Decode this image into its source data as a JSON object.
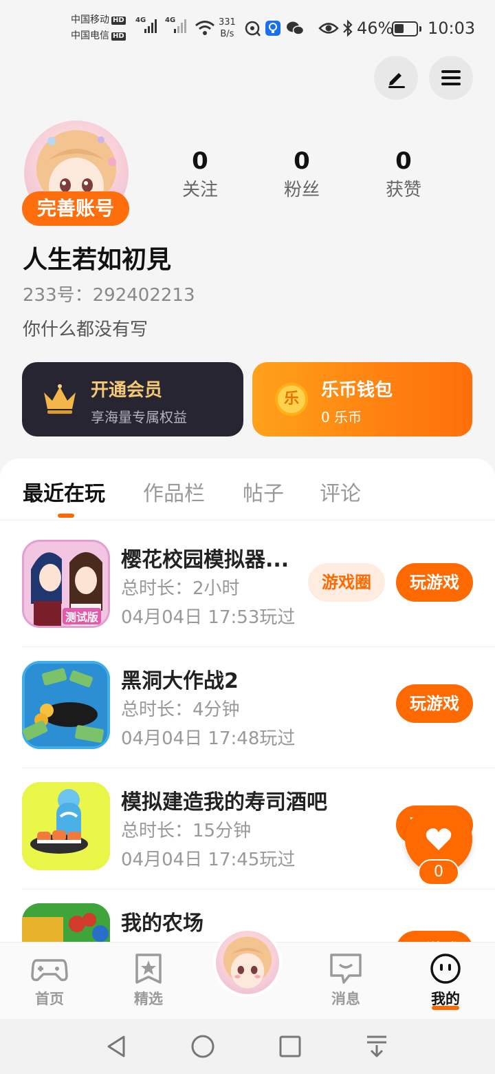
{
  "status_bar": {
    "carrier_1": "中国移动",
    "carrier_2": "中国电信",
    "hd": "HD",
    "net_type": "4G",
    "speed_value": "331",
    "speed_unit": "B/s",
    "battery_percent": "46%",
    "battery_level": 0.46,
    "time": "10:03"
  },
  "header": {
    "edit_icon": "pencil-icon",
    "menu_icon": "hamburger-menu-icon"
  },
  "profile": {
    "complete_label": "完善账号",
    "nickname": "人生若如初見",
    "uid": "233号：292402213",
    "bio": "你什么都没有写",
    "stats": [
      {
        "value": "0",
        "label": "关注"
      },
      {
        "value": "0",
        "label": "粉丝"
      },
      {
        "value": "0",
        "label": "获赞"
      }
    ]
  },
  "cards": {
    "vip": {
      "title": "开通会员",
      "subtitle": "享海量专属权益"
    },
    "wallet": {
      "title": "乐币钱包",
      "subtitle": "0 乐币",
      "coin_glyph": "乐"
    }
  },
  "tabs": [
    "最近在玩",
    "作品栏",
    "帖子",
    "评论"
  ],
  "games": [
    {
      "name": "樱花校园模拟器...",
      "duration": "总时长：2小时",
      "last_played": "04月04日 17:53玩过",
      "circle_label": "游戏圈",
      "play_label": "玩游戏",
      "icon_badge": "测试版"
    },
    {
      "name": "黑洞大作战2",
      "duration": "总时长：4分钟",
      "last_played": "04月04日 17:48玩过",
      "play_label": "玩游戏"
    },
    {
      "name": "模拟建造我的寿司酒吧",
      "duration": "总时长：15分钟",
      "last_played": "04月04日 17:45玩过",
      "play_label": "玩游戏"
    },
    {
      "name": "我的农场",
      "play_label": "玩游戏"
    }
  ],
  "like": {
    "count": "0"
  },
  "bottom_nav": [
    {
      "label": "首页",
      "icon": "gamepad-icon"
    },
    {
      "label": "精选",
      "icon": "star-bookmark-icon"
    },
    {
      "label": "",
      "icon": "avatar"
    },
    {
      "label": "消息",
      "icon": "chat-bubble-icon"
    },
    {
      "label": "我的",
      "icon": "face-icon"
    }
  ],
  "colors": {
    "accent": "#ff6a00",
    "vip_bg": "#272532",
    "vip_text": "#f5c873"
  }
}
